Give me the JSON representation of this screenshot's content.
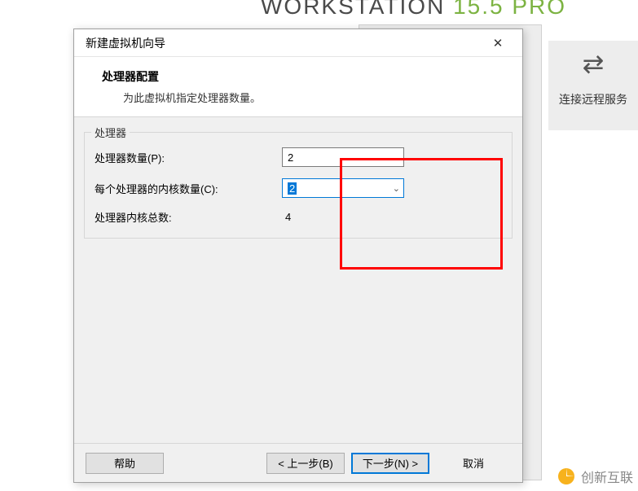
{
  "background": {
    "brand_prefix": "WORKSTATION",
    "brand_version": "15.5",
    "brand_suffix": "PRO",
    "connect_label": "连接远程服务"
  },
  "dialog": {
    "window_title": "新建虚拟机向导",
    "header_title": "处理器配置",
    "header_desc": "为此虚拟机指定处理器数量。",
    "fieldset_legend": "处理器",
    "rows": {
      "processors_label": "处理器数量(P):",
      "processors_value": "2",
      "cores_label": "每个处理器的内核数量(C):",
      "cores_value": "2",
      "total_label": "处理器内核总数:",
      "total_value": "4"
    },
    "buttons": {
      "help": "帮助",
      "back": "< 上一步(B)",
      "next": "下一步(N) >",
      "cancel": "取消"
    }
  },
  "watermark": {
    "text": "创新互联"
  }
}
